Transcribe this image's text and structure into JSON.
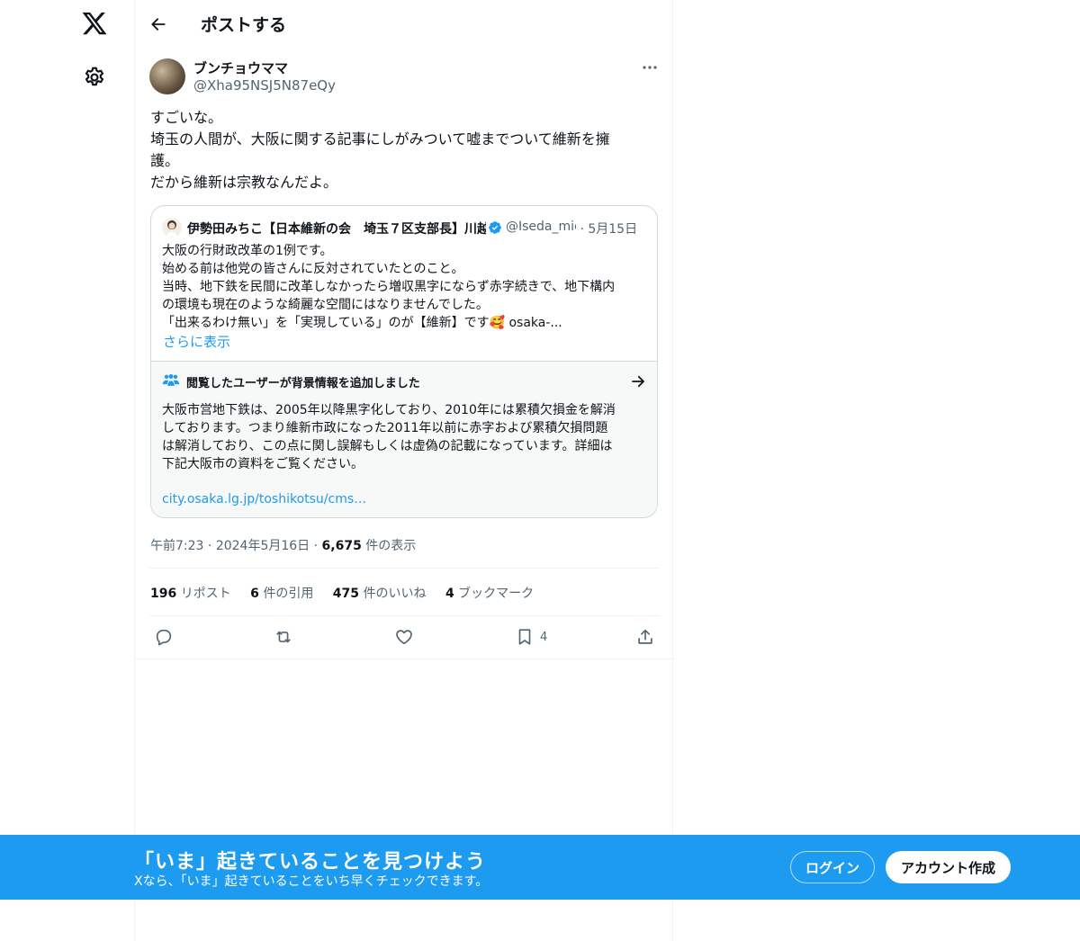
{
  "header": {
    "title": "ポストする"
  },
  "author": {
    "name": "ブンチョウママ",
    "handle": "@Xha95NSJ5N87eQy"
  },
  "tweet": {
    "lines": [
      "すごいな。",
      "埼玉の人間が、大阪に関する記事にしがみついて嘘までついて維新を擁",
      "護。",
      "だから維新は宗教なんだよ。"
    ]
  },
  "quote": {
    "name": "伊勢田みちこ【日本維新の会　埼玉７区支部長】川越",
    "handle": "@Iseda_michiko",
    "dot": "·",
    "date": "5月15日",
    "lines": [
      "大阪の行財政改革の1例です。",
      "始める前は他党の皆さんに反対されていたとのこと。",
      "当時、地下鉄を民間に改革しなかったら増収黒字にならず赤字続きで、地下構内",
      "の環境も現在のような綺麗な空間にはなりませんでした。",
      "「出来るわけ無い」を「実現している」のが【維新】です🥰 osaka-..."
    ],
    "show_more": "さらに表示"
  },
  "note": {
    "title": "閲覧したユーザーが背景情報を追加しました",
    "lines": [
      "大阪市営地下鉄は、2005年以降黒字化しており、2010年には累積欠損金を解消",
      "しております。つまり維新市政になった2011年以前に赤字および累積欠損問題",
      "は解消しており、この点に関し誤解もしくは虚偽の記載になっています。詳細は",
      "下記大阪市の資料をご覧ください。"
    ],
    "link": "city.osaka.lg.jp/toshikotsu/cms…"
  },
  "meta": {
    "time": "午前7:23",
    "sep1": "·",
    "date": "2024年5月16日",
    "sep2": "·",
    "views_count": "6,675",
    "views_label": "件の表示"
  },
  "stats": {
    "reposts_count": "196",
    "reposts_label": "リポスト",
    "quotes_count": "6",
    "quotes_label": "件の引用",
    "likes_count": "475",
    "likes_label": "件のいいね",
    "bookmarks_count": "4",
    "bookmarks_label": "ブックマーク"
  },
  "actions": {
    "bookmark_count": "4"
  },
  "banner": {
    "title": "「いま」起きていることを見つけよう",
    "subtitle": "Xなら、「いま」起きていることをいち早くチェックできます。",
    "login": "ログイン",
    "signup": "アカウント作成"
  },
  "colors": {
    "accent": "#1d9bf0",
    "text": "#0f1419",
    "muted": "#536471",
    "border": "#cfd9de"
  },
  "icons": [
    "x-logo-icon",
    "gear-icon",
    "back-arrow-icon",
    "more-icon",
    "verified-badge-icon",
    "users-icon",
    "arrow-right-icon",
    "reply-icon",
    "repost-icon",
    "like-icon",
    "bookmark-icon",
    "share-icon"
  ]
}
